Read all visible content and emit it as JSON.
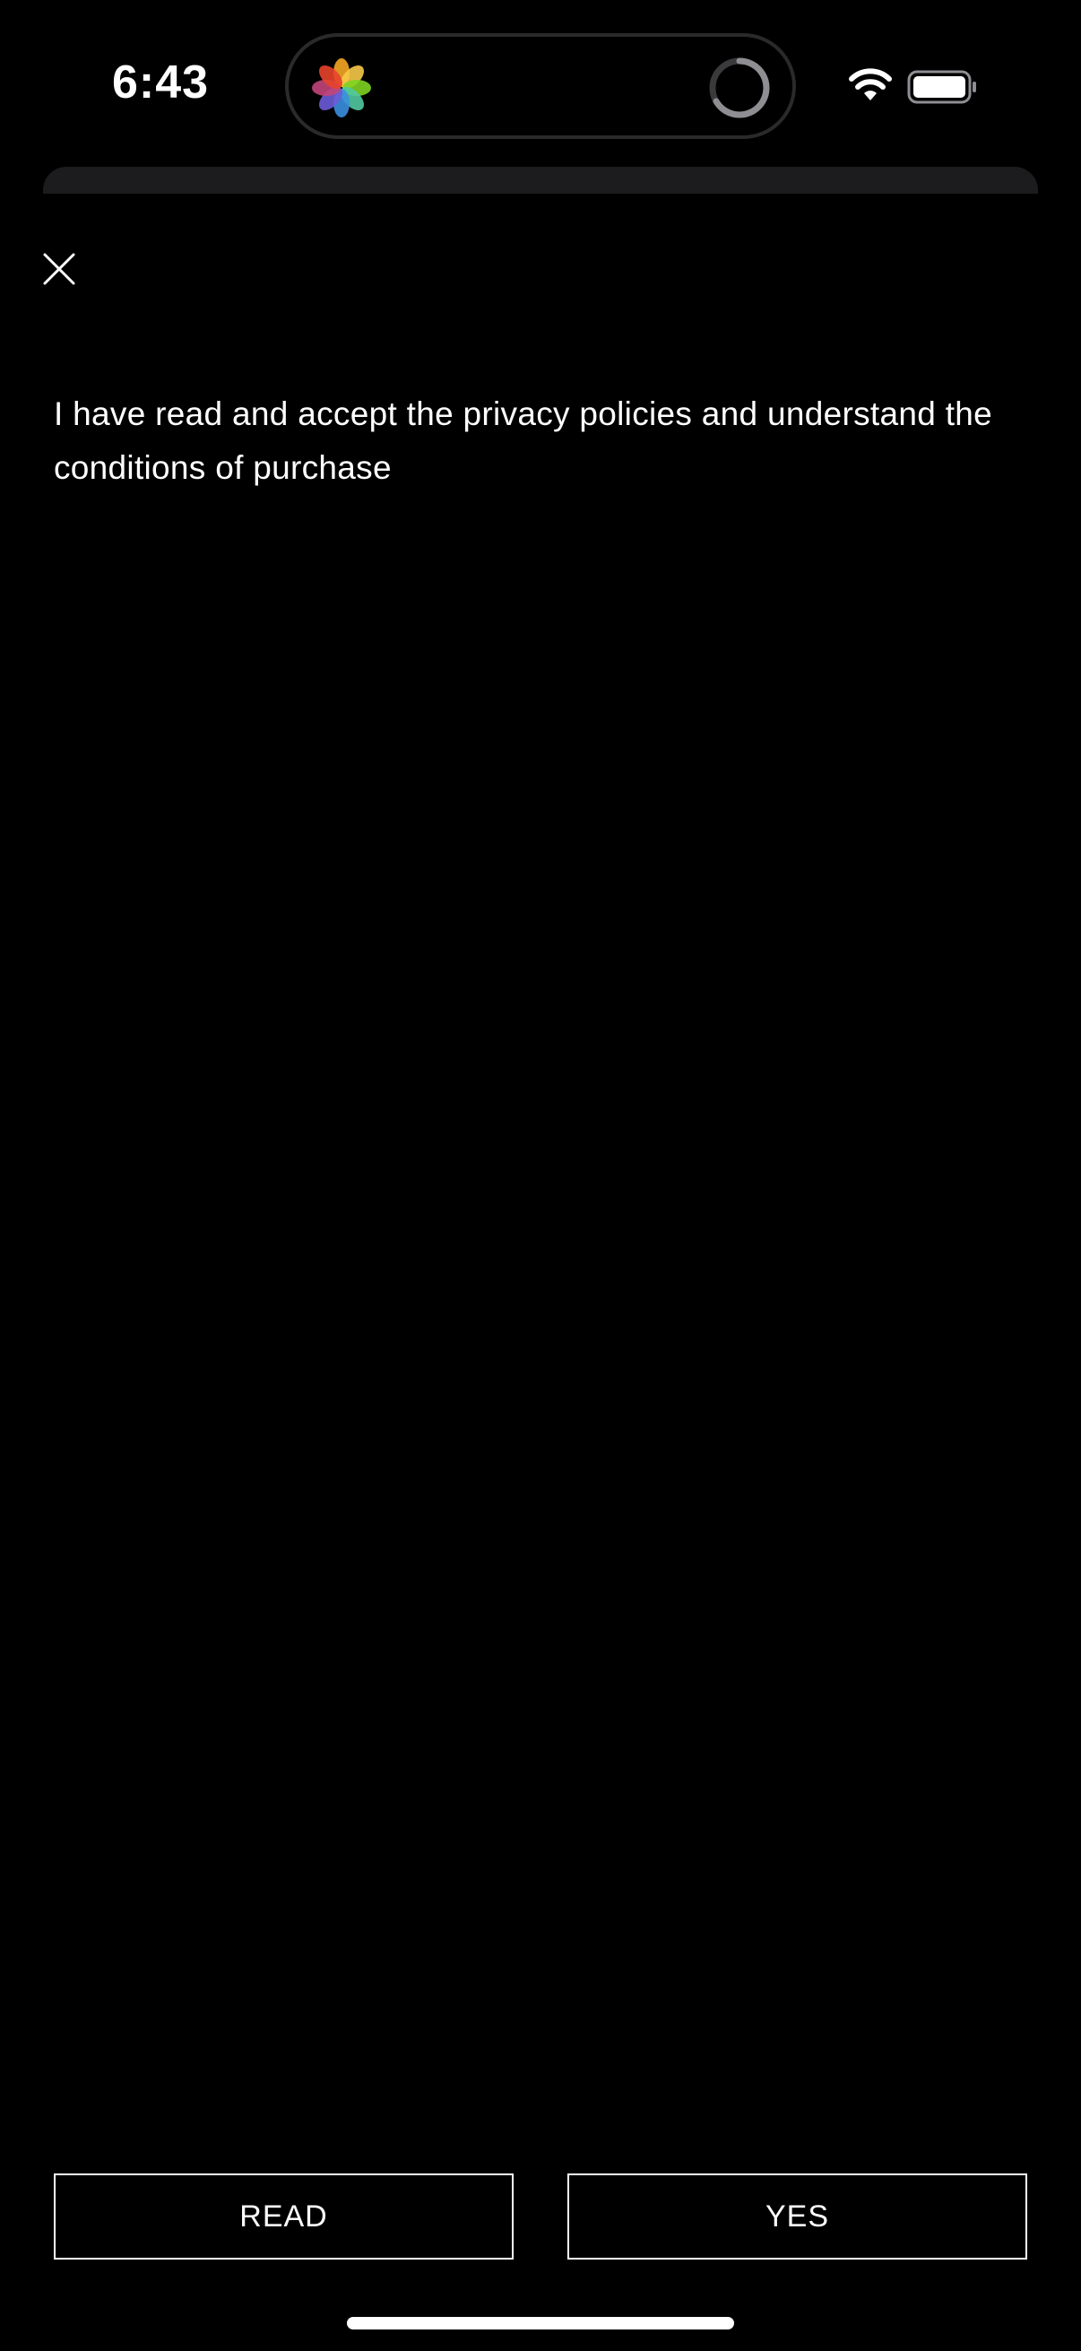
{
  "status_bar": {
    "time": "6:43",
    "icons": [
      "photos-icon",
      "activity-spinner-icon",
      "wifi-icon",
      "battery-icon"
    ]
  },
  "dialog": {
    "close_icon": "close-icon",
    "message": "I have read and accept the privacy policies and understand the conditions of purchase",
    "buttons": {
      "read_label": "READ",
      "yes_label": "YES"
    }
  },
  "colors": {
    "background": "#000000",
    "text": "#ffffff",
    "sheet_edge": "#1c1c1e"
  }
}
